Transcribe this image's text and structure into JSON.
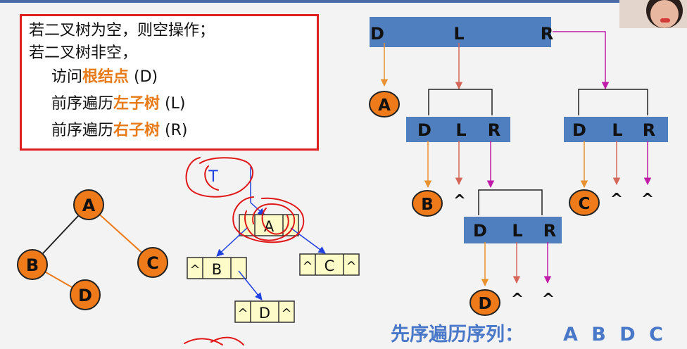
{
  "rules": {
    "line1": "若二叉树为空，则空操作；",
    "line2": "若二叉树非空，",
    "line3": {
      "pre": "访问",
      "hl": "根结点",
      "post": " (D)"
    },
    "line4": {
      "pre": "前序遍历",
      "hl": "左子树",
      "post": " (L)"
    },
    "line5": {
      "pre": "前序遍历",
      "hl": "右子树",
      "post": " (R)"
    }
  },
  "tree": {
    "a": "A",
    "b": "B",
    "c": "C",
    "d": "D"
  },
  "linked": {
    "root_label": "T",
    "null": "^",
    "a": "A",
    "b": "B",
    "c": "C",
    "d": "D"
  },
  "traversal": {
    "d": "D",
    "l": "L",
    "r": "R",
    "null": "^",
    "a": "A",
    "b": "B",
    "c": "C",
    "dnode": "D",
    "result_label": "先序遍历序列：",
    "result_seq": "A B D C"
  },
  "colors": {
    "node_fill": "#ee7a1a",
    "bar_fill": "#4f7fbf",
    "edge_black": "#222222",
    "edge_orange": "#ee7a1a",
    "arrow_orange": "#e8912f",
    "arrow_red": "#d4665a",
    "arrow_magenta": "#c01aa8",
    "pointer_blue": "#2040e0",
    "cell_fill": "#fdfbc8",
    "scribble_red": "#e01818"
  },
  "icons": {
    "webcam": "presenter-webcam"
  }
}
